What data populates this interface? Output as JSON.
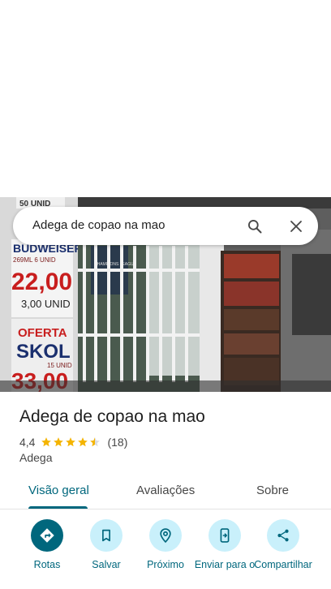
{
  "search": {
    "query": "Adega de copao na mao"
  },
  "place": {
    "name": "Adega de copao na mao",
    "rating": "4,4",
    "rating_value": 4.4,
    "review_count": "(18)",
    "category": "Adega"
  },
  "photo_signs": {
    "sign1": "BUDWEISER",
    "sign1_sub": "269ML  6 UNID",
    "price1": "22,00",
    "price1_sub": "3,00 UNID",
    "offer": "OFERTA",
    "brand2": "SKOL",
    "brand2_sub": "15 UNID",
    "price2": "33,00",
    "top_sign": "50 UNID",
    "poster": "CHAMPIONS LEAGUE"
  },
  "tabs": [
    {
      "label": "Visão geral",
      "active": true
    },
    {
      "label": "Avaliações",
      "active": false
    },
    {
      "label": "Sobre",
      "active": false
    }
  ],
  "actions": [
    {
      "label": "Rotas",
      "icon": "directions-icon"
    },
    {
      "label": "Salvar",
      "icon": "bookmark-icon"
    },
    {
      "label": "Próximo",
      "icon": "nearby-icon"
    },
    {
      "label": "Enviar para o",
      "icon": "send-to-phone-icon"
    },
    {
      "label": "Compartilhar",
      "icon": "share-icon"
    }
  ],
  "colors": {
    "accent": "#00677d",
    "accent_light": "#c9f0fb",
    "star": "#f4b400",
    "text_primary": "#1f1f1f",
    "text_secondary": "#474747"
  }
}
